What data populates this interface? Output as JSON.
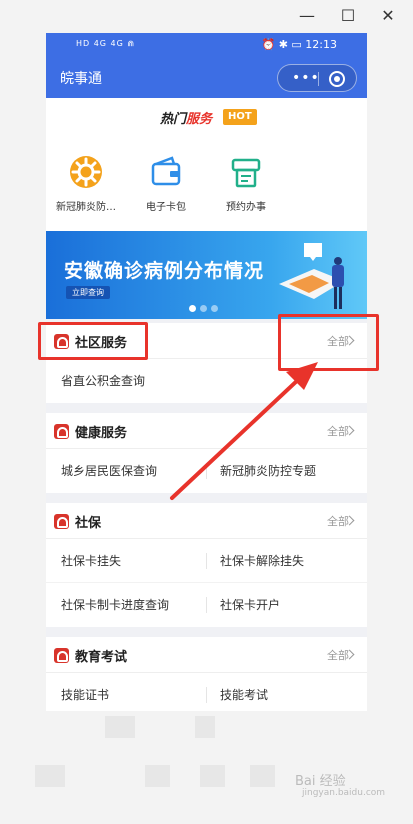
{
  "window": {
    "minimize": "—",
    "maximize": "☐",
    "close": "✕"
  },
  "status_bar": {
    "left": "HD 4G 4G ⋒",
    "right": "⏰ ✱ ▭ 12:13"
  },
  "app": {
    "title": "皖事通"
  },
  "hot": {
    "title_part1": "热门",
    "title_part2": "服务",
    "badge": "HOT",
    "items": [
      {
        "label": "新冠肺炎防…",
        "icon": "virus-gear-icon"
      },
      {
        "label": "电子卡包",
        "icon": "wallet-icon"
      },
      {
        "label": "预约办事",
        "icon": "ticket-printer-icon"
      }
    ]
  },
  "banner": {
    "title": "安徽确诊病例分布情况",
    "button": "立即查询"
  },
  "sections": [
    {
      "title": "社区服务",
      "more": "全部",
      "rows": [
        [
          "省直公积金查询",
          ""
        ]
      ]
    },
    {
      "title": "健康服务",
      "more": "全部",
      "rows": [
        [
          "城乡居民医保查询",
          "新冠肺炎防控专题"
        ]
      ]
    },
    {
      "title": "社保",
      "more": "全部",
      "rows": [
        [
          "社保卡挂失",
          "社保卡解除挂失"
        ],
        [
          "社保卡制卡进度查询",
          "社保卡开户"
        ]
      ]
    },
    {
      "title": "教育考试",
      "more": "全部",
      "rows": [
        [
          "技能证书",
          "技能考试"
        ]
      ]
    }
  ],
  "watermark": {
    "main": "Bai 经验",
    "sub": "jingyan.baidu.com"
  },
  "colors": {
    "primary": "#3d6ee4",
    "accent": "#e8332b",
    "hot": "#f4a21b"
  }
}
